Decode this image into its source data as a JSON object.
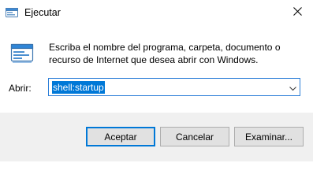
{
  "window": {
    "title": "Ejecutar",
    "title_icon": "run-app-icon",
    "close_icon": "close-icon"
  },
  "dialog": {
    "icon": "run-dialog-icon",
    "description": "Escriba el nombre del programa, carpeta, documento o recurso de Internet que desea abrir con Windows.",
    "open_label": "Abrir:",
    "open_value": "shell:startup",
    "dropdown_icon": "chevron-down-icon"
  },
  "buttons": {
    "ok": "Aceptar",
    "cancel": "Cancelar",
    "browse": "Examinar..."
  },
  "colors": {
    "accent": "#0078d7",
    "footer_bg": "#f0f0f0",
    "button_bg": "#e1e1e1"
  }
}
